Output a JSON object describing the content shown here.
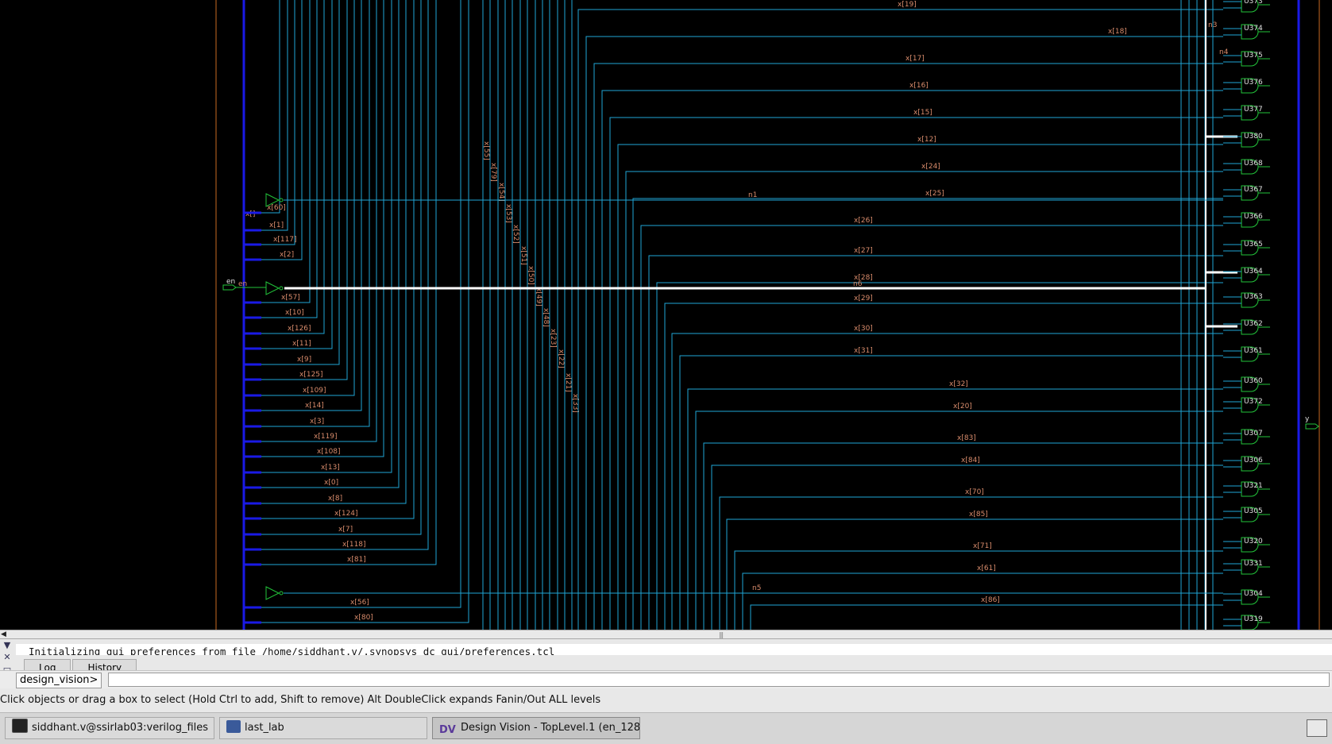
{
  "schematic": {
    "left_nets": [
      "x[60]",
      "x[1]",
      "x[117]",
      "x[2]",
      "x[57]",
      "x[10]",
      "x[126]",
      "x[11]",
      "x[9]",
      "x[125]",
      "x[109]",
      "x[14]",
      "x[3]",
      "x[119]",
      "x[108]",
      "x[13]",
      "x[0]",
      "x[8]",
      "x[124]",
      "x[7]",
      "x[118]",
      "x[81]",
      "x[56]",
      "x[80]"
    ],
    "vertical_nets": [
      "x[55]",
      "x[79]",
      "x[54]",
      "x[53]",
      "x[52]",
      "x[51]",
      "x[50]",
      "x[49]",
      "x[48]",
      "x[23]",
      "x[22]",
      "x[21]",
      "x[33]"
    ],
    "right_nets": [
      "x[19]",
      "x[18]",
      "x[17]",
      "x[16]",
      "x[15]",
      "x[12]",
      "x[24]",
      "x[25]",
      "x[26]",
      "x[27]",
      "x[28]",
      "x[29]",
      "x[30]",
      "x[31]",
      "x[32]",
      "x[20]",
      "x[83]",
      "x[84]",
      "x[70]",
      "x[85]",
      "x[71]",
      "x[61]",
      "x[86]"
    ],
    "cells": [
      "U373",
      "U374",
      "U375",
      "U376",
      "U377",
      "U380",
      "U368",
      "U367",
      "U366",
      "U365",
      "U364",
      "U363",
      "U362",
      "U361",
      "U360",
      "U372",
      "U307",
      "U306",
      "U321",
      "U305",
      "U320",
      "U331",
      "U304",
      "U319"
    ],
    "bus_port_label": "x[]",
    "en_label": "en",
    "en_net_label": "en",
    "net_n1": "n1",
    "net_n6": "n6",
    "net_n5": "n5",
    "net_n3": "n3",
    "net_n4": "n4",
    "output_label": "y"
  },
  "console": {
    "log_line": "Initializing gui preferences from file  /home/siddhant.v/.synopsys_dc_gui/preferences.tcl",
    "tabs": [
      "Log",
      "History"
    ],
    "prompt": "design_vision>",
    "command_value": ""
  },
  "statusbar": {
    "text": "Click objects or drag a box to select (Hold Ctrl to add, Shift to remove) Alt DoubleClick expands Fanin/Out ALL levels"
  },
  "taskbar": {
    "items": [
      {
        "label": "siddhant.v@ssirlab03:verilog_files",
        "icon": "terminal-icon"
      },
      {
        "label": "last_lab",
        "icon": "file-manager-icon"
      },
      {
        "label": "Design Vision - TopLevel.1 (en_128)",
        "icon": "design-vision-icon"
      }
    ]
  },
  "colors": {
    "background": "#000000",
    "bus": "#1a1ae6",
    "wire": "#1fa6d6",
    "label": "#d98c6c",
    "gate": "#22c43a",
    "selected": "#ffffff",
    "frame": "#c96a22"
  }
}
